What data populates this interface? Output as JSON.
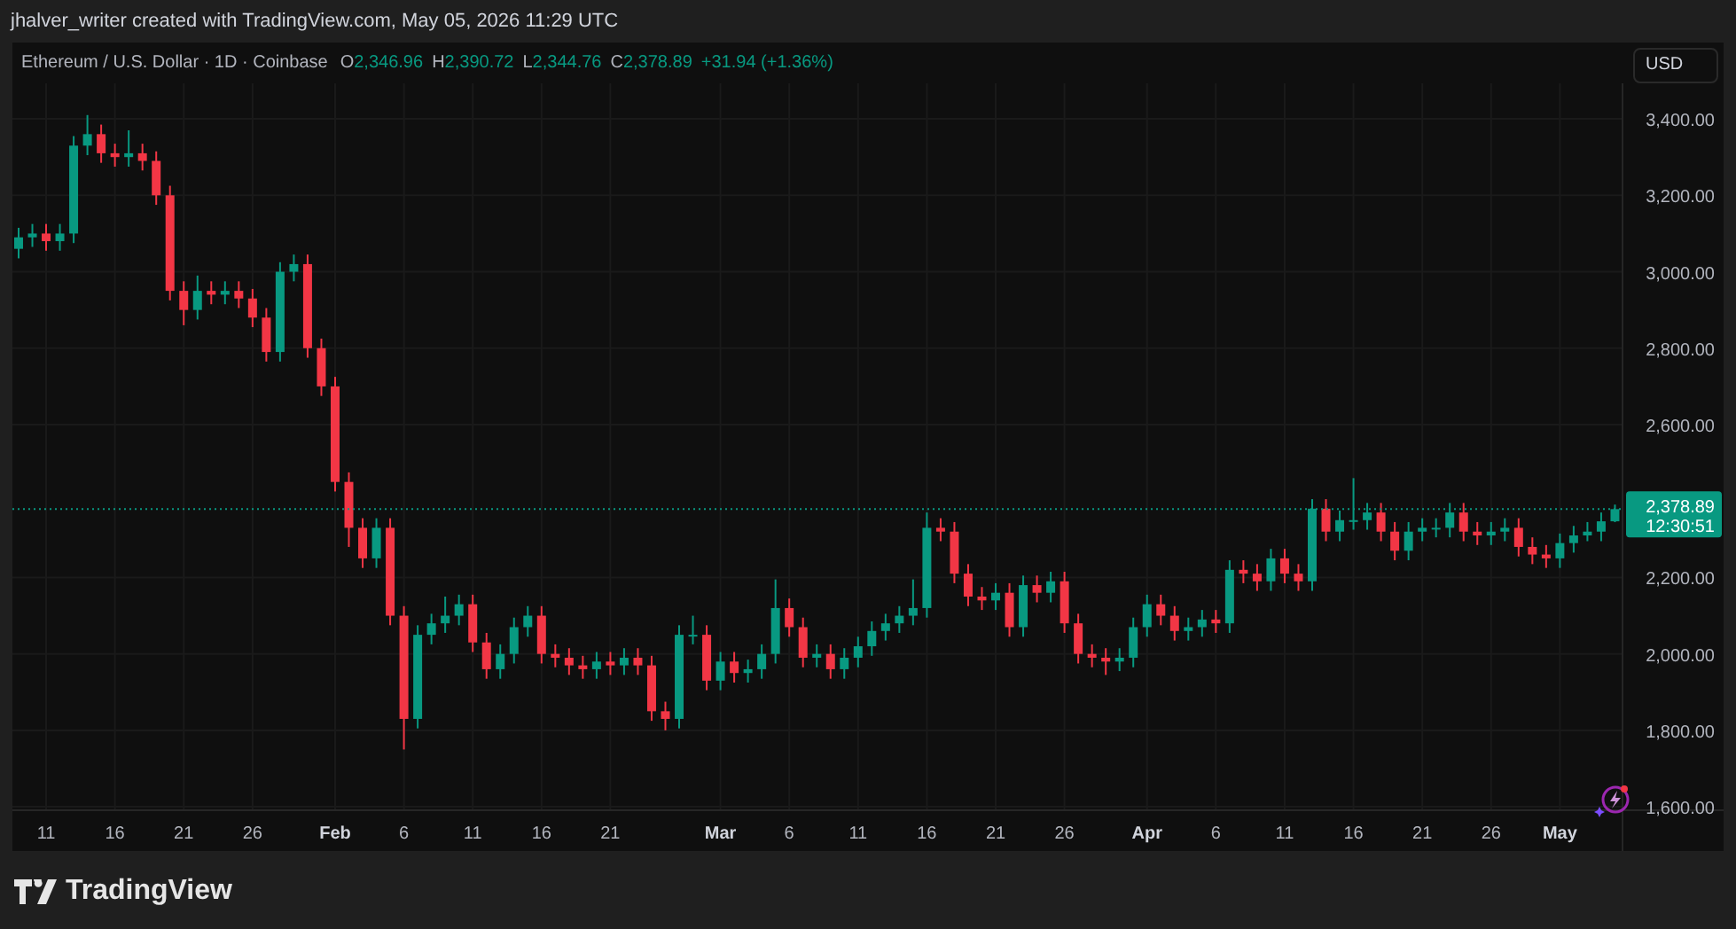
{
  "attribution": "jhalver_writer created with TradingView.com, May 05, 2026 11:29 UTC",
  "legend": {
    "title": "Ethereum / U.S. Dollar · 1D · Coinbase",
    "ohlc": [
      {
        "label": "O",
        "value": "2,346.96"
      },
      {
        "label": "H",
        "value": "2,390.72"
      },
      {
        "label": "L",
        "value": "2,344.76"
      },
      {
        "label": "C",
        "value": "2,378.89"
      }
    ],
    "change": "+31.94 (+1.36%)"
  },
  "currency_button": "USD",
  "chart_data": {
    "type": "candlestick",
    "yticks": [
      {
        "value": 1600,
        "label": "1,600.00"
      },
      {
        "value": 1800,
        "label": "1,800.00"
      },
      {
        "value": 2000,
        "label": "2,000.00"
      },
      {
        "value": 2200,
        "label": "2,200.00"
      },
      {
        "value": 2600,
        "label": "2,600.00"
      },
      {
        "value": 2800,
        "label": "2,800.00"
      },
      {
        "value": 3000,
        "label": "3,000.00"
      },
      {
        "value": 3200,
        "label": "3,200.00"
      },
      {
        "value": 3400,
        "label": "3,400.00"
      }
    ],
    "ylim": [
      1591,
      3493
    ],
    "grid": true,
    "categories": [
      null,
      null,
      "11",
      null,
      null,
      null,
      null,
      "16",
      null,
      null,
      null,
      null,
      "21",
      null,
      null,
      null,
      null,
      "26",
      null,
      null,
      null,
      null,
      null,
      "Feb",
      null,
      null,
      null,
      null,
      "6",
      null,
      null,
      null,
      null,
      "11",
      null,
      null,
      null,
      null,
      "16",
      null,
      null,
      null,
      null,
      "21",
      null,
      null,
      null,
      null,
      null,
      null,
      null,
      "Mar",
      null,
      null,
      null,
      null,
      "6",
      null,
      null,
      null,
      null,
      "11",
      null,
      null,
      null,
      null,
      "16",
      null,
      null,
      null,
      null,
      "21",
      null,
      null,
      null,
      null,
      "26",
      null,
      null,
      null,
      null,
      null,
      "Apr",
      null,
      null,
      null,
      null,
      "6",
      null,
      null,
      null,
      null,
      "11",
      null,
      null,
      null,
      null,
      "16",
      null,
      null,
      null,
      null,
      "21",
      null,
      null,
      null,
      null,
      "26",
      null,
      null,
      null,
      null,
      "May",
      null,
      null,
      null,
      null
    ],
    "ref_lines": [
      {
        "axis": "y",
        "value": 2378.89,
        "color": "#089981"
      }
    ],
    "ohlc": [
      [
        3060,
        3115,
        3035,
        3090
      ],
      [
        3090,
        3125,
        3065,
        3100
      ],
      [
        3100,
        3125,
        3055,
        3080
      ],
      [
        3080,
        3125,
        3055,
        3100
      ],
      [
        3100,
        3355,
        3075,
        3330
      ],
      [
        3330,
        3410,
        3305,
        3360
      ],
      [
        3360,
        3385,
        3285,
        3310
      ],
      [
        3310,
        3335,
        3275,
        3300
      ],
      [
        3300,
        3370,
        3275,
        3310
      ],
      [
        3310,
        3335,
        3265,
        3290
      ],
      [
        3290,
        3315,
        3175,
        3200
      ],
      [
        3200,
        3225,
        2925,
        2950
      ],
      [
        2950,
        2975,
        2860,
        2900
      ],
      [
        2900,
        2990,
        2875,
        2950
      ],
      [
        2950,
        2975,
        2915,
        2940
      ],
      [
        2940,
        2975,
        2915,
        2950
      ],
      [
        2950,
        2975,
        2905,
        2930
      ],
      [
        2930,
        2955,
        2855,
        2880
      ],
      [
        2880,
        2905,
        2765,
        2790
      ],
      [
        2790,
        3025,
        2765,
        3000
      ],
      [
        3000,
        3045,
        2975,
        3020
      ],
      [
        3020,
        3045,
        2775,
        2800
      ],
      [
        2800,
        2825,
        2675,
        2700
      ],
      [
        2700,
        2725,
        2425,
        2450
      ],
      [
        2450,
        2475,
        2280,
        2330
      ],
      [
        2330,
        2355,
        2225,
        2250
      ],
      [
        2250,
        2355,
        2225,
        2330
      ],
      [
        2330,
        2355,
        2075,
        2100
      ],
      [
        2100,
        2125,
        1750,
        1830
      ],
      [
        1830,
        2075,
        1805,
        2050
      ],
      [
        2050,
        2105,
        2025,
        2080
      ],
      [
        2080,
        2150,
        2055,
        2100
      ],
      [
        2100,
        2155,
        2075,
        2130
      ],
      [
        2130,
        2155,
        2005,
        2030
      ],
      [
        2030,
        2055,
        1935,
        1960
      ],
      [
        1960,
        2025,
        1935,
        2000
      ],
      [
        2000,
        2095,
        1975,
        2070
      ],
      [
        2070,
        2125,
        2045,
        2100
      ],
      [
        2100,
        2125,
        1975,
        2000
      ],
      [
        2000,
        2025,
        1965,
        1990
      ],
      [
        1990,
        2015,
        1945,
        1970
      ],
      [
        1970,
        1995,
        1935,
        1960
      ],
      [
        1960,
        2005,
        1935,
        1980
      ],
      [
        1980,
        2005,
        1945,
        1970
      ],
      [
        1970,
        2015,
        1945,
        1990
      ],
      [
        1990,
        2015,
        1945,
        1970
      ],
      [
        1970,
        1995,
        1825,
        1850
      ],
      [
        1850,
        1875,
        1800,
        1830
      ],
      [
        1830,
        2075,
        1805,
        2050
      ],
      [
        2050,
        2100,
        2025,
        2050
      ],
      [
        2050,
        2075,
        1905,
        1930
      ],
      [
        1930,
        2005,
        1905,
        1980
      ],
      [
        1980,
        2005,
        1925,
        1950
      ],
      [
        1950,
        1985,
        1925,
        1960
      ],
      [
        1960,
        2025,
        1935,
        2000
      ],
      [
        2000,
        2195,
        1975,
        2120
      ],
      [
        2120,
        2145,
        2045,
        2070
      ],
      [
        2070,
        2095,
        1965,
        1990
      ],
      [
        1990,
        2025,
        1965,
        2000
      ],
      [
        2000,
        2025,
        1935,
        1960
      ],
      [
        1960,
        2015,
        1935,
        1990
      ],
      [
        1990,
        2045,
        1965,
        2020
      ],
      [
        2020,
        2085,
        1995,
        2060
      ],
      [
        2060,
        2105,
        2035,
        2080
      ],
      [
        2080,
        2125,
        2055,
        2100
      ],
      [
        2100,
        2195,
        2075,
        2120
      ],
      [
        2120,
        2370,
        2095,
        2330
      ],
      [
        2330,
        2355,
        2295,
        2320
      ],
      [
        2320,
        2345,
        2185,
        2210
      ],
      [
        2210,
        2235,
        2125,
        2150
      ],
      [
        2150,
        2175,
        2115,
        2140
      ],
      [
        2140,
        2185,
        2115,
        2160
      ],
      [
        2160,
        2185,
        2045,
        2070
      ],
      [
        2070,
        2205,
        2045,
        2180
      ],
      [
        2180,
        2205,
        2135,
        2160
      ],
      [
        2160,
        2215,
        2135,
        2190
      ],
      [
        2190,
        2215,
        2055,
        2080
      ],
      [
        2080,
        2105,
        1975,
        2000
      ],
      [
        2000,
        2025,
        1965,
        1990
      ],
      [
        1990,
        2015,
        1945,
        1980
      ],
      [
        1980,
        2015,
        1955,
        1990
      ],
      [
        1990,
        2095,
        1965,
        2070
      ],
      [
        2070,
        2155,
        2045,
        2130
      ],
      [
        2130,
        2155,
        2075,
        2100
      ],
      [
        2100,
        2125,
        2035,
        2060
      ],
      [
        2060,
        2095,
        2035,
        2070
      ],
      [
        2070,
        2115,
        2045,
        2090
      ],
      [
        2090,
        2115,
        2055,
        2080
      ],
      [
        2080,
        2245,
        2055,
        2220
      ],
      [
        2220,
        2245,
        2185,
        2210
      ],
      [
        2210,
        2235,
        2165,
        2190
      ],
      [
        2190,
        2275,
        2165,
        2250
      ],
      [
        2250,
        2275,
        2185,
        2210
      ],
      [
        2210,
        2235,
        2165,
        2190
      ],
      [
        2190,
        2405,
        2165,
        2380
      ],
      [
        2380,
        2405,
        2295,
        2320
      ],
      [
        2320,
        2375,
        2295,
        2350
      ],
      [
        2350,
        2460,
        2325,
        2350
      ],
      [
        2350,
        2395,
        2325,
        2370
      ],
      [
        2370,
        2395,
        2295,
        2320
      ],
      [
        2320,
        2345,
        2245,
        2270
      ],
      [
        2270,
        2345,
        2245,
        2320
      ],
      [
        2320,
        2355,
        2295,
        2330
      ],
      [
        2330,
        2355,
        2305,
        2330
      ],
      [
        2330,
        2395,
        2305,
        2370
      ],
      [
        2370,
        2395,
        2295,
        2320
      ],
      [
        2320,
        2345,
        2285,
        2310
      ],
      [
        2310,
        2345,
        2285,
        2320
      ],
      [
        2320,
        2355,
        2295,
        2330
      ],
      [
        2330,
        2355,
        2255,
        2280
      ],
      [
        2280,
        2305,
        2235,
        2260
      ],
      [
        2260,
        2285,
        2225,
        2250
      ],
      [
        2250,
        2315,
        2225,
        2290
      ],
      [
        2290,
        2335,
        2265,
        2310
      ],
      [
        2310,
        2345,
        2295,
        2320
      ],
      [
        2320,
        2370,
        2295,
        2346.96
      ],
      [
        2346.96,
        2390.72,
        2344.76,
        2378.89
      ]
    ]
  },
  "last_price": {
    "price": "2,378.89",
    "countdown": "12:30:51"
  },
  "brand": "TradingView"
}
